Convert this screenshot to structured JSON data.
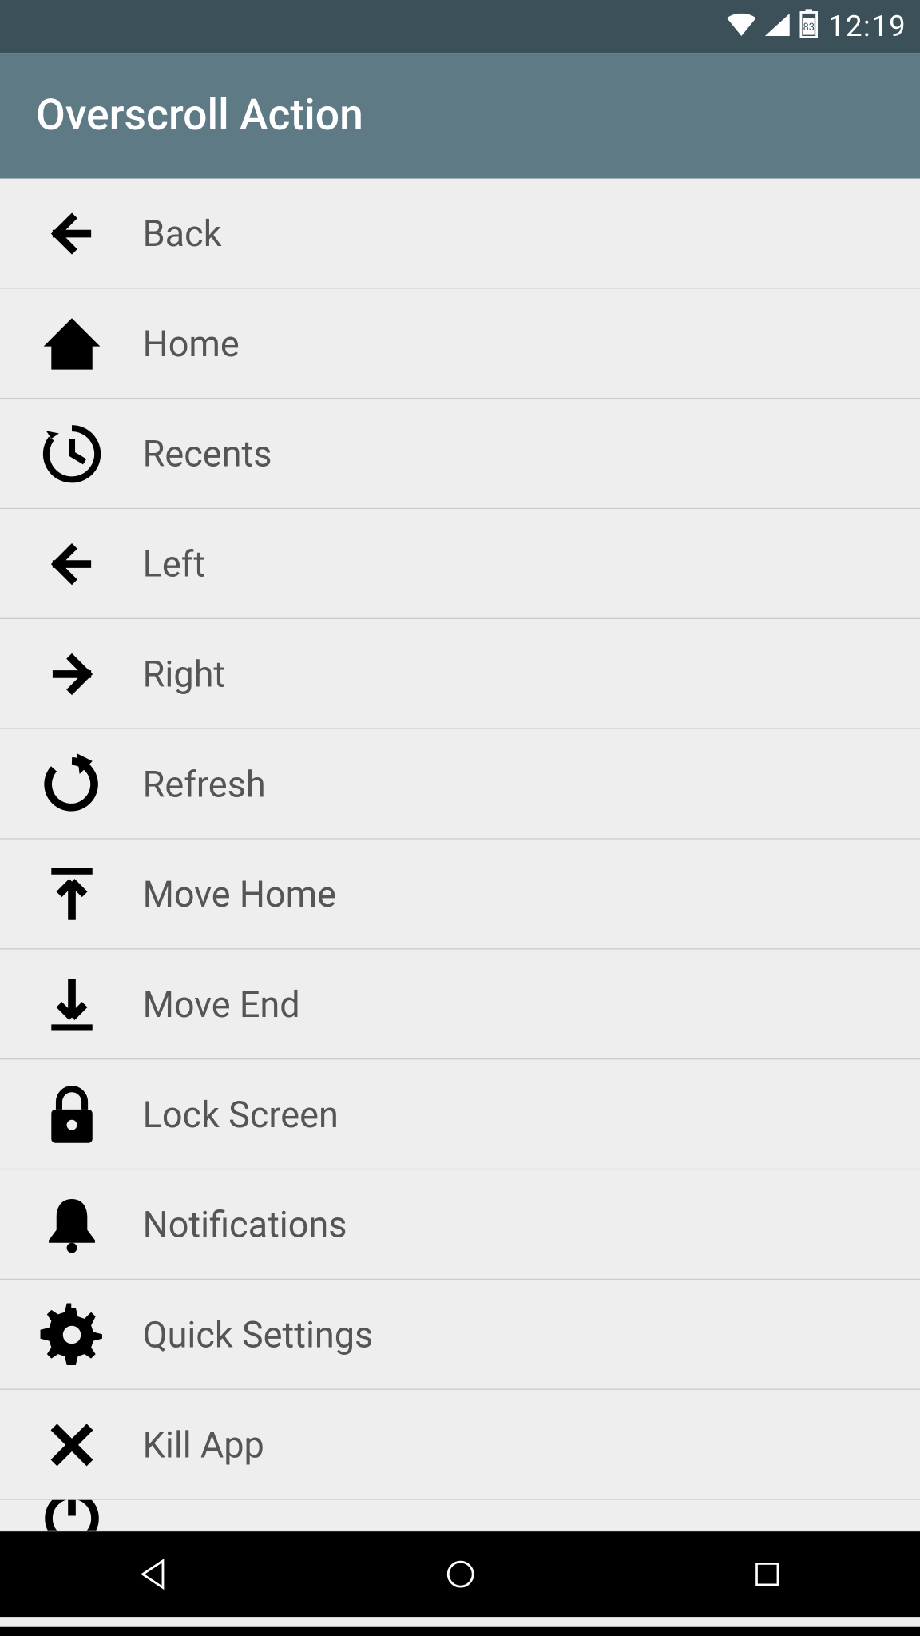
{
  "status_bar": {
    "time": "12:19",
    "battery": "83"
  },
  "app_bar": {
    "title": "Overscroll Action"
  },
  "actions": [
    {
      "icon": "arrow-back",
      "label": "Back"
    },
    {
      "icon": "home",
      "label": "Home"
    },
    {
      "icon": "history",
      "label": "Recents"
    },
    {
      "icon": "arrow-back",
      "label": "Left"
    },
    {
      "icon": "arrow-forward",
      "label": "Right"
    },
    {
      "icon": "refresh",
      "label": "Refresh"
    },
    {
      "icon": "move-top",
      "label": "Move Home"
    },
    {
      "icon": "move-bottom",
      "label": "Move End"
    },
    {
      "icon": "lock",
      "label": "Lock Screen"
    },
    {
      "icon": "bell",
      "label": "Notifications"
    },
    {
      "icon": "gear",
      "label": "Quick Settings"
    },
    {
      "icon": "close",
      "label": "Kill App"
    }
  ],
  "partial_icon": "power"
}
